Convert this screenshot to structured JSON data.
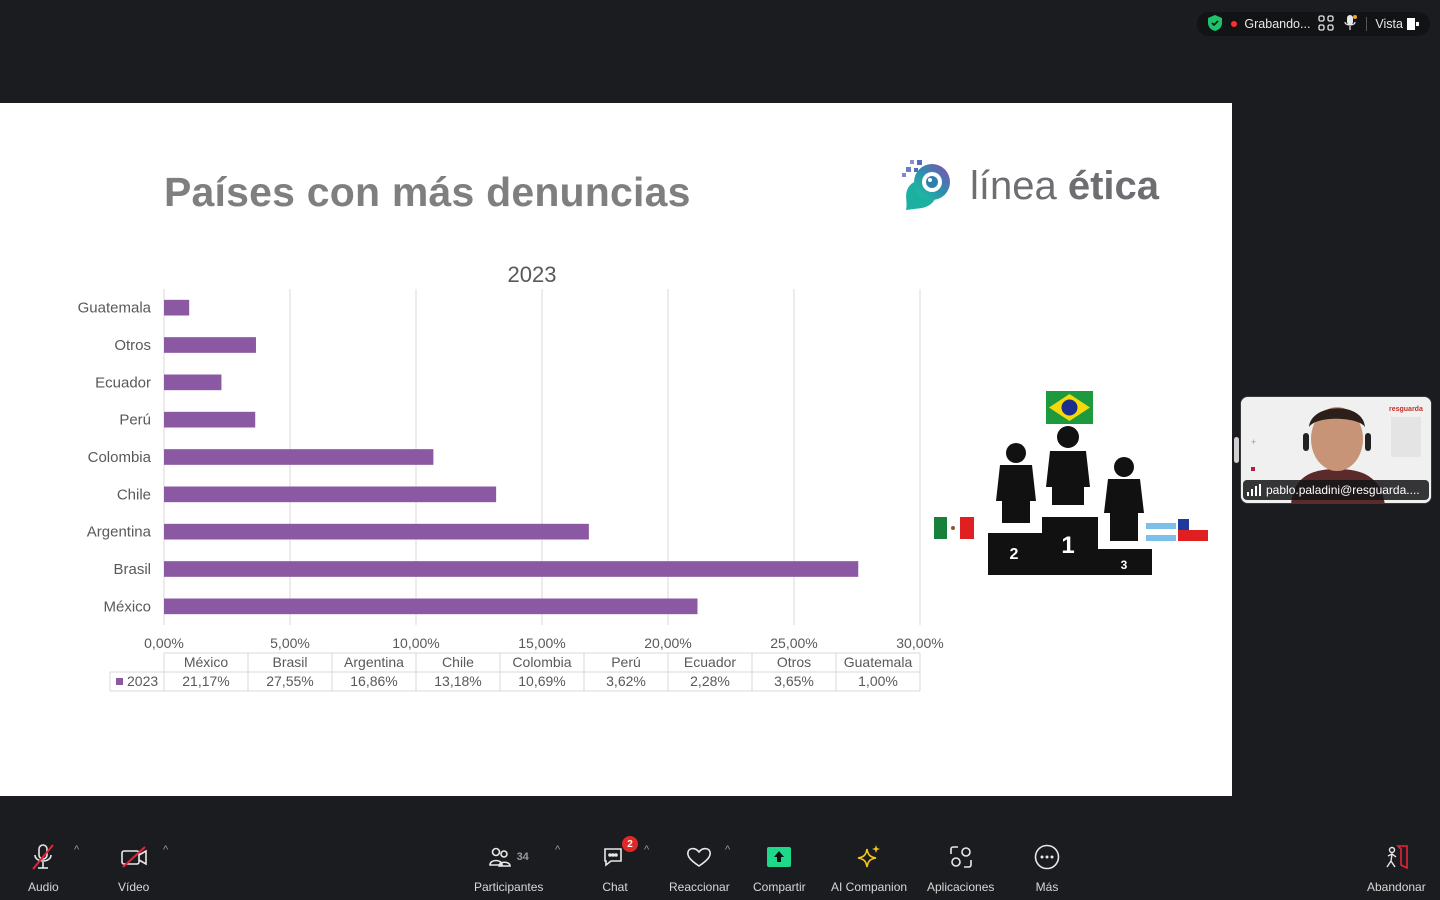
{
  "topbar": {
    "recording_label": "Grabando...",
    "view_label": "Vista",
    "shield_color": "#1ec26b",
    "rec_color": "#ff2d2d"
  },
  "slide": {
    "title": "Países con más denuncias",
    "logo_light": "línea ",
    "logo_bold": "ética"
  },
  "chart_data": {
    "type": "bar",
    "orientation": "horizontal",
    "title": "2023",
    "categories": [
      "México",
      "Brasil",
      "Argentina",
      "Chile",
      "Colombia",
      "Perú",
      "Ecuador",
      "Otros",
      "Guatemala"
    ],
    "series": [
      {
        "name": "2023",
        "values": [
          21.17,
          27.55,
          16.86,
          13.18,
          10.69,
          3.62,
          2.28,
          3.65,
          1.0
        ],
        "color": "#8b59a3"
      }
    ],
    "xlim": [
      0,
      30
    ],
    "xticks": [
      "0,00%",
      "5,00%",
      "10,00%",
      "15,00%",
      "20,00%",
      "25,00%",
      "30,00%"
    ],
    "data_table": {
      "legend_label": "2023",
      "values_text": [
        "21,17%",
        "27,55%",
        "16,86%",
        "13,18%",
        "10,69%",
        "3,62%",
        "2,28%",
        "3,65%",
        "1,00%"
      ]
    },
    "grid": true,
    "xlabel": "",
    "ylabel": ""
  },
  "podium": {
    "first": "Brasil",
    "second": "México",
    "third": "Argentina / Chile"
  },
  "video": {
    "participant_name": "pablo.paladini@resguarda....",
    "brand_label": "resguarda"
  },
  "toolbar": {
    "audio": "Audio",
    "video": "Vídeo",
    "participants": "Participantes",
    "participants_count": "34",
    "chat": "Chat",
    "chat_badge": "2",
    "react": "Reaccionar",
    "share": "Compartir",
    "ai": "AI Companion",
    "apps": "Aplicaciones",
    "more": "Más",
    "leave": "Abandonar",
    "share_color": "#1ed98a",
    "ai_color": "#f5c518",
    "leave_color": "#e5243a"
  }
}
